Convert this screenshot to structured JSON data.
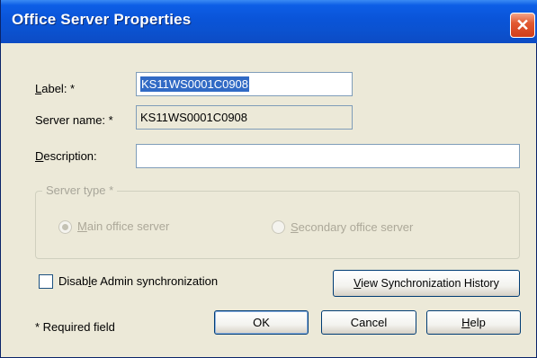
{
  "window": {
    "title": "Office Server Properties",
    "close_glyph": "✕",
    "accent_color": "#0a54d8"
  },
  "form": {
    "label_field": {
      "label_prefix": "",
      "label_mnemonic": "L",
      "label_rest": "abel: *",
      "value": "KS11WS0001C0908"
    },
    "server_name": {
      "label": "Server name: *",
      "value": "KS11WS0001C0908"
    },
    "description": {
      "label_mnemonic": "D",
      "label_rest": "escription:",
      "value": ""
    }
  },
  "server_type": {
    "legend": "Server type *",
    "options": [
      {
        "mnemonic": "M",
        "rest": "ain office server",
        "selected": true,
        "disabled": true
      },
      {
        "mnemonic": "S",
        "rest": "econdary office server",
        "selected": false,
        "disabled": true
      }
    ]
  },
  "sync": {
    "checkbox_label_prefix": "Disab",
    "checkbox_label_mnemonic": "l",
    "checkbox_label_rest": "e Admin synchronization",
    "checked": false,
    "history_button_mnemonic": "V",
    "history_button_rest": "iew Synchronization History"
  },
  "footer": {
    "required_note": "* Required field",
    "ok_label": "OK",
    "cancel_label": "Cancel",
    "help_mnemonic": "H",
    "help_rest": "elp"
  }
}
